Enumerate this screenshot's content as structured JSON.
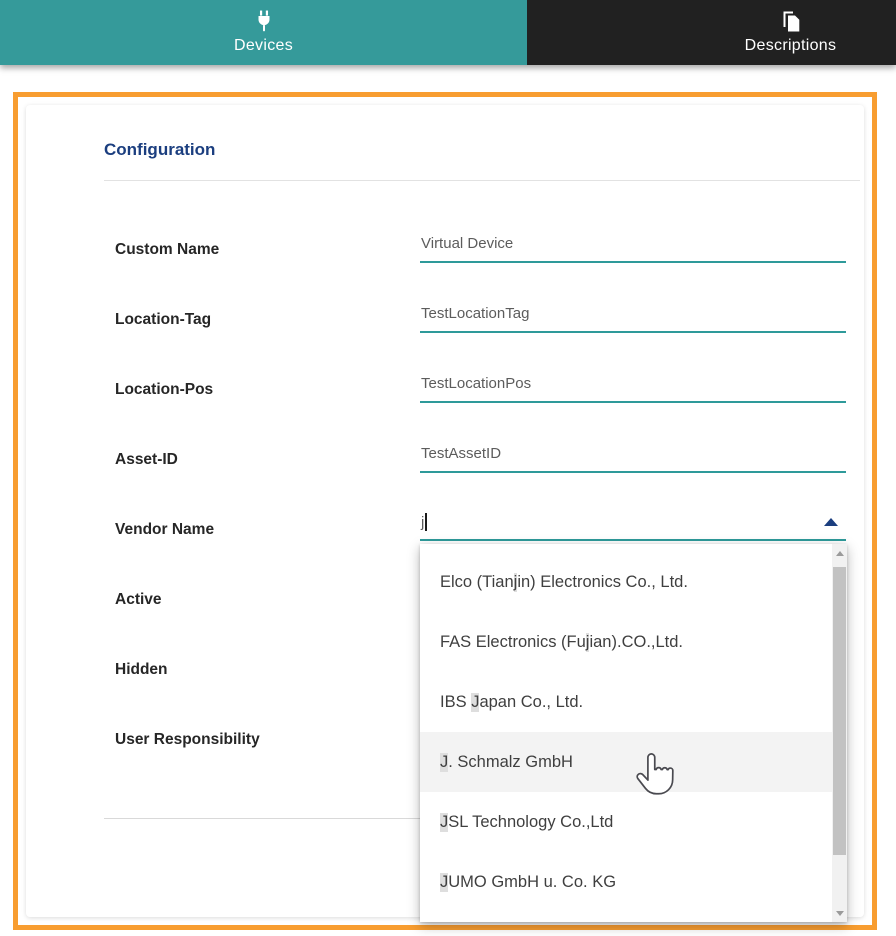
{
  "header": {
    "tabs": [
      {
        "label": "Devices",
        "icon": "plug-icon",
        "active": true
      },
      {
        "label": "Descriptions",
        "icon": "copy-pages-icon",
        "active": false
      }
    ]
  },
  "panel": {
    "title": "Configuration"
  },
  "form": {
    "rows": [
      {
        "label": "Custom Name",
        "value": "Virtual Device"
      },
      {
        "label": "Location-Tag",
        "value": "TestLocationTag"
      },
      {
        "label": "Location-Pos",
        "value": "TestLocationPos"
      },
      {
        "label": "Asset-ID",
        "value": "TestAssetID"
      },
      {
        "label": "Vendor Name",
        "value": "j"
      },
      {
        "label": "Active"
      },
      {
        "label": "Hidden"
      },
      {
        "label": "User Responsibility"
      }
    ]
  },
  "dropdown": {
    "items": [
      {
        "pre": "Elco (Tian",
        "match": "j",
        "post": "in) Electronics Co., Ltd.",
        "hovered": false
      },
      {
        "pre": "FAS Electronics (Fu",
        "match": "j",
        "post": "ian).CO.,Ltd.",
        "hovered": false
      },
      {
        "pre": "IBS ",
        "match": "J",
        "post": "apan Co., Ltd.",
        "hovered": false
      },
      {
        "pre": "",
        "match": "J",
        "post": ". Schmalz GmbH",
        "hovered": true
      },
      {
        "pre": "",
        "match": "J",
        "post": "SL Technology Co.,Ltd",
        "hovered": false
      },
      {
        "pre": "",
        "match": "J",
        "post": "UMO GmbH u. Co. KG",
        "hovered": false
      }
    ]
  },
  "colors": {
    "tab_active_teal": "#359a9a",
    "tab_inactive_dark": "#212121",
    "frame_orange": "#f89d30",
    "heading_navy": "#1b3e7f",
    "input_underline_teal": "#2e9a9a",
    "match_highlight_gray": "#dedede"
  }
}
